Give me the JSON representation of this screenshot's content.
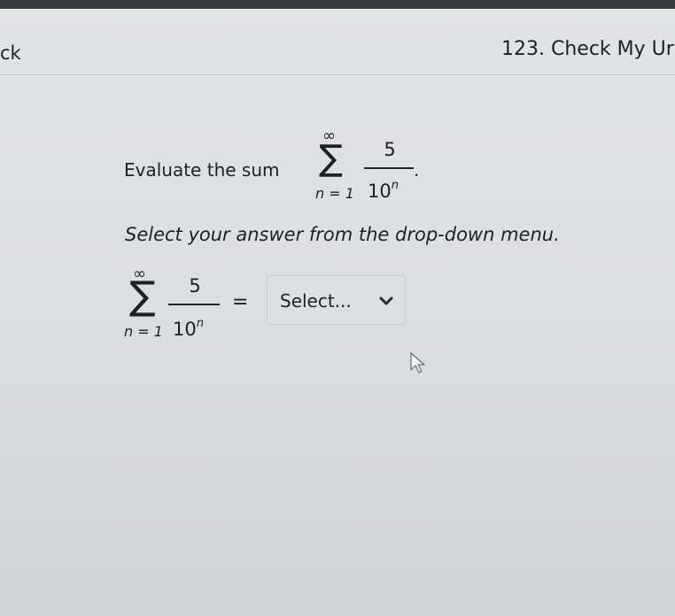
{
  "header": {
    "back_label": "ck",
    "title": "123. Check My Ur"
  },
  "problem": {
    "prompt": "Evaluate the sum",
    "period": ".",
    "sum": {
      "upper": "∞",
      "sigma": "∑",
      "lower": "n = 1",
      "numerator": "5",
      "den_base": "10",
      "den_exp": "n"
    },
    "instruction": "Select your answer from the drop-down menu.",
    "equals": "="
  },
  "answer_select": {
    "value": "Select..."
  },
  "icons": {
    "chevron": "chevron-down-icon",
    "cursor": "mouse-pointer-icon"
  }
}
